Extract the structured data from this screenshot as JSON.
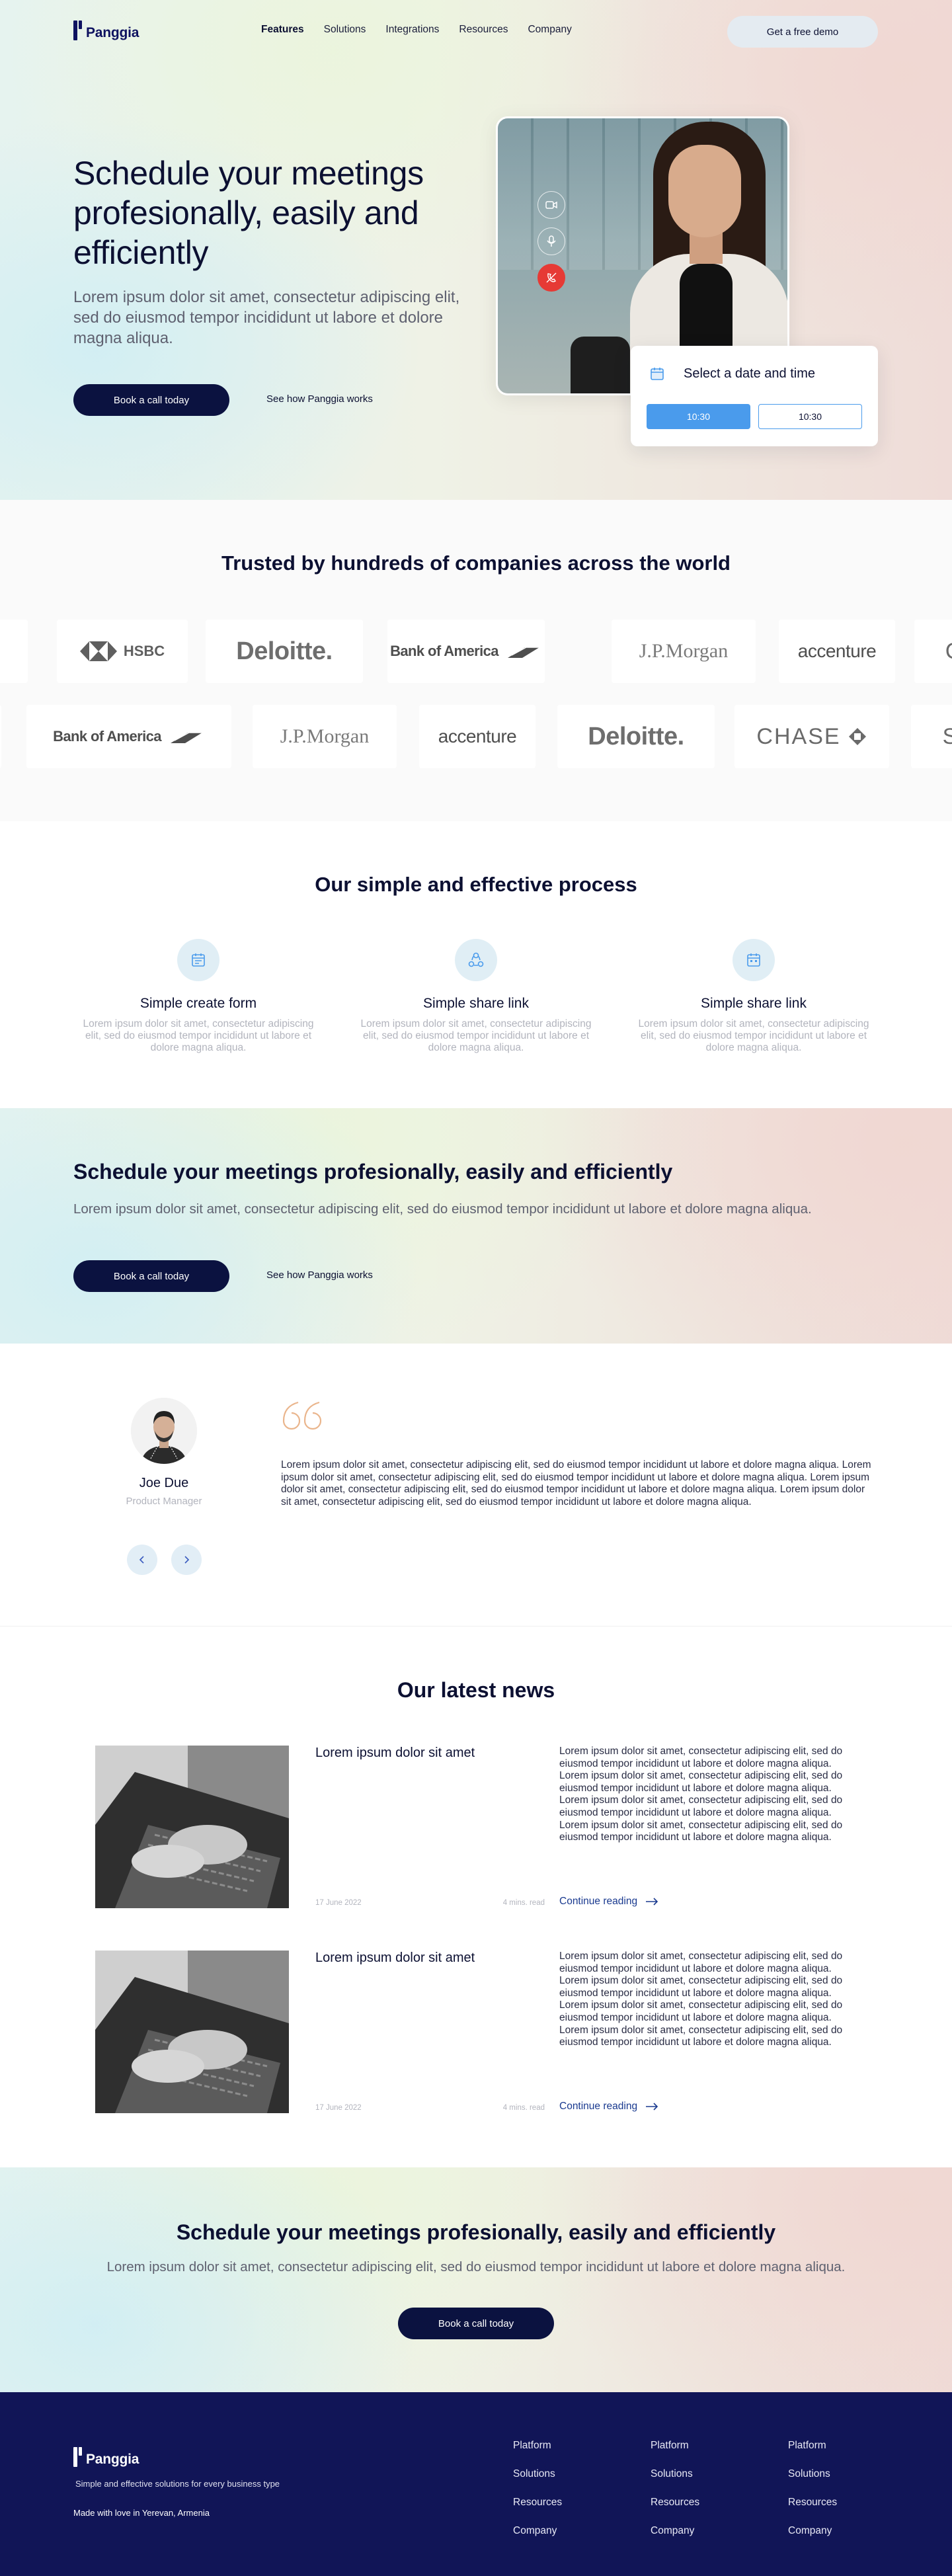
{
  "brand": {
    "name": "Panggia",
    "tagline": "Simple and effective solutions for every business type",
    "made_with": "Made with love in Yerevan, Armenia"
  },
  "colors": {
    "navy": "#0b1240",
    "accent_blue": "#4a9bec",
    "footer_bg": "#111557",
    "end_call": "#e63a35",
    "link_blue": "#1a3a8f"
  },
  "nav": {
    "links": [
      {
        "label": "Features",
        "active": true
      },
      {
        "label": "Solutions",
        "active": false
      },
      {
        "label": "Integrations",
        "active": false
      },
      {
        "label": "Resources",
        "active": false
      },
      {
        "label": "Company",
        "active": false
      }
    ],
    "demo_button": "Get a free demo"
  },
  "hero": {
    "title": "Schedule your meetings profesionally, easily and efficiently",
    "subtitle": "Lorem ipsum dolor sit amet, consectetur adipiscing elit, sed do eiusmod tempor incididunt ut labore et dolore magna aliqua.",
    "primary_button": "Book a call today",
    "secondary_link": "See how Panggia works",
    "call_controls": [
      "video-icon",
      "microphone-icon",
      "end-call-icon"
    ],
    "date_card": {
      "title": "Select a date and time",
      "times": [
        {
          "label": "10:30",
          "selected": true
        },
        {
          "label": "10:30",
          "selected": false
        }
      ]
    }
  },
  "trusted": {
    "title": "Trusted by hundreds of companies across the world",
    "row1": [
      "HSBC",
      "Deloitte.",
      "Bank of America",
      "J.P.Morgan",
      "accenture"
    ],
    "row2": [
      "Bank of America",
      "J.P.Morgan",
      "accenture",
      "Deloitte.",
      "CHASE"
    ]
  },
  "process": {
    "title": "Our simple and effective process",
    "items": [
      {
        "icon": "form-icon",
        "title": "Simple create form",
        "desc": "Lorem ipsum dolor sit amet, consectetur adipiscing elit, sed do eiusmod tempor incididunt ut labore et dolore magna aliqua."
      },
      {
        "icon": "share-icon",
        "title": "Simple share link",
        "desc": "Lorem ipsum dolor sit amet, consectetur adipiscing elit, sed do eiusmod tempor incididunt ut labore et dolore magna aliqua."
      },
      {
        "icon": "calendar-icon",
        "title": "Simple share link",
        "desc": "Lorem ipsum dolor sit amet, consectetur adipiscing elit, sed do eiusmod tempor incididunt ut labore et dolore magna aliqua."
      }
    ]
  },
  "cta": {
    "title": "Schedule your meetings profesionally, easily and efficiently",
    "text": "Lorem ipsum dolor sit amet, consectetur adipiscing elit, sed do eiusmod tempor incididunt ut labore et dolore magna aliqua.",
    "primary_button": "Book a call today",
    "secondary_link": "See how Panggia works"
  },
  "testimonial": {
    "name": "Joe Due",
    "role": "Product Manager",
    "text": "Lorem ipsum dolor sit amet, consectetur adipiscing elit, sed do eiusmod tempor incididunt ut labore et dolore magna aliqua.  Lorem ipsum dolor sit amet, consectetur adipiscing elit, sed do eiusmod tempor incididunt ut labore et dolore magna aliqua. Lorem ipsum dolor sit amet, consectetur adipiscing elit, sed do eiusmod tempor incididunt ut labore et dolore magna aliqua. Lorem ipsum dolor sit amet, consectetur adipiscing elit, sed do eiusmod tempor incididunt ut labore et dolore magna aliqua."
  },
  "news": {
    "title": "Our latest news",
    "items": [
      {
        "title": "Lorem ipsum dolor sit amet",
        "date": "17 June 2022",
        "read_time": "4 mins. read",
        "excerpt": "Lorem ipsum dolor sit amet, consectetur adipiscing elit, sed do eiusmod tempor incididunt ut labore et dolore magna aliqua.  Lorem ipsum dolor sit amet, consectetur adipiscing elit, sed do eiusmod tempor incididunt ut labore et dolore magna aliqua. Lorem ipsum dolor sit amet, consectetur adipiscing elit, sed do eiusmod tempor incididunt ut labore et dolore magna aliqua. Lorem ipsum dolor sit amet, consectetur adipiscing elit, sed do eiusmod tempor incididunt ut labore et dolore magna aliqua.",
        "link": "Continue reading"
      },
      {
        "title": "Lorem ipsum dolor sit amet",
        "date": "17 June 2022",
        "read_time": "4 mins. read",
        "excerpt": "Lorem ipsum dolor sit amet, consectetur adipiscing elit, sed do eiusmod tempor incididunt ut labore et dolore magna aliqua.  Lorem ipsum dolor sit amet, consectetur adipiscing elit, sed do eiusmod tempor incididunt ut labore et dolore magna aliqua. Lorem ipsum dolor sit amet, consectetur adipiscing elit, sed do eiusmod tempor incididunt ut labore et dolore magna aliqua. Lorem ipsum dolor sit amet, consectetur adipiscing elit, sed do eiusmod tempor incididunt ut labore et dolore magna aliqua.",
        "link": "Continue reading"
      }
    ]
  },
  "cta2": {
    "title": "Schedule your meetings profesionally, easily and efficiently",
    "text": "Lorem ipsum dolor sit amet, consectetur adipiscing elit, sed do eiusmod tempor incididunt ut labore et dolore magna aliqua.",
    "button": "Book a call today"
  },
  "footer": {
    "columns": [
      [
        "Platform",
        "Solutions",
        "Resources",
        "Company"
      ],
      [
        "Platform",
        "Solutions",
        "Resources",
        "Company"
      ],
      [
        "Platform",
        "Solutions",
        "Resources",
        "Company"
      ]
    ]
  }
}
